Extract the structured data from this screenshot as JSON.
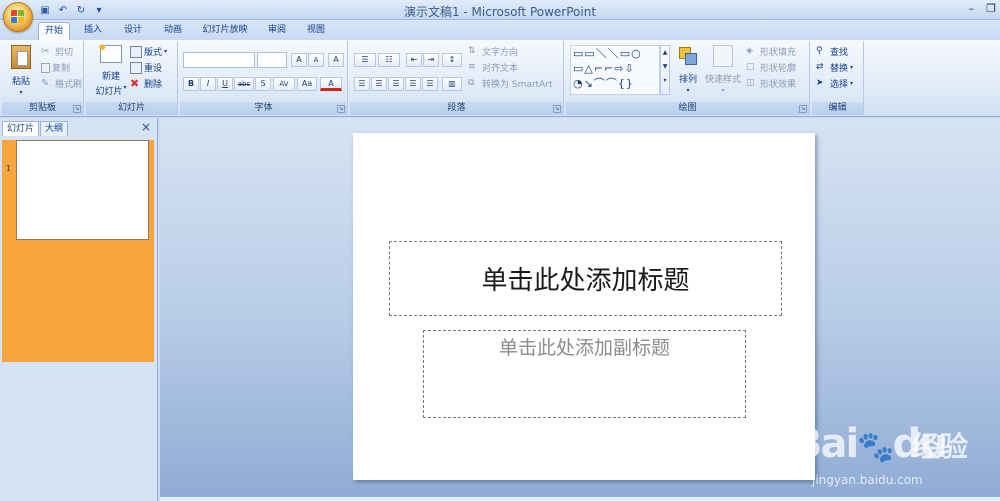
{
  "window": {
    "title": "演示文稿1 - Microsoft PowerPoint",
    "restore_glyph": "❐",
    "close_glyph": "✕",
    "minimize_glyph": "–"
  },
  "qat": {
    "save": "💾",
    "undo": "↶",
    "redo": "↻",
    "customize": "▾"
  },
  "tabs": [
    "开始",
    "插入",
    "设计",
    "动画",
    "幻灯片放映",
    "审阅",
    "视图"
  ],
  "active_tab": "开始",
  "clipboard": {
    "label": "剪贴板",
    "paste": "粘贴",
    "cut": "剪切",
    "copy": "复制",
    "format_painter": "格式刷"
  },
  "slides_group": {
    "label": "幻灯片",
    "new_slide_1": "新建",
    "new_slide_2": "幻灯片",
    "layout": "版式",
    "reset": "重设",
    "delete": "删除"
  },
  "font_group": {
    "label": "字体",
    "grow": "A",
    "shrink": "A",
    "clear": "A",
    "bold": "B",
    "italic": "I",
    "underline": "U",
    "strike": "abc",
    "shadow": "S",
    "spacing": "AV",
    "case": "Aa",
    "color": "A"
  },
  "paragraph_group": {
    "label": "段落",
    "text_direction": "文字方向",
    "align_text": "对齐文本",
    "smartart": "转换为 SmartArt"
  },
  "drawing_group": {
    "label": "绘图",
    "arrange": "排列",
    "quick_styles": "快速样式",
    "shape_fill": "形状填充",
    "shape_outline": "形状轮廓",
    "shape_effects": "形状效果"
  },
  "editing_group": {
    "label": "编辑",
    "find": "查找",
    "replace": "替换",
    "select": "选择"
  },
  "left_pane": {
    "tab_slides": "幻灯片",
    "tab_outline": "大纲",
    "close": "×",
    "slide_number": "1"
  },
  "slide": {
    "title_placeholder": "单击此处添加标题",
    "subtitle_placeholder": "单击此处添加副标题"
  },
  "watermark": {
    "brand": "Bai",
    "brand2": "du",
    "cn": "经验",
    "url": "jingyan.baidu.com"
  },
  "colors": {
    "ribbon_text": "#15428b",
    "title_bar": "#c5d8f2",
    "thumb_highlight": "#f7a53e"
  }
}
